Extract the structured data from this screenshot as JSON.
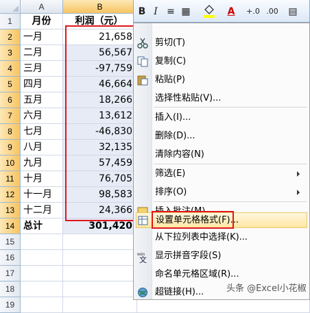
{
  "columns": [
    "A",
    "B"
  ],
  "rows": [
    {
      "num": "1",
      "a": "月份",
      "b": "利润（元）"
    },
    {
      "num": "2",
      "a": "一月",
      "b": "21,658"
    },
    {
      "num": "3",
      "a": "二月",
      "b": "56,567"
    },
    {
      "num": "4",
      "a": "三月",
      "b": "-97,759"
    },
    {
      "num": "5",
      "a": "四月",
      "b": "46,664"
    },
    {
      "num": "6",
      "a": "五月",
      "b": "18,266"
    },
    {
      "num": "7",
      "a": "六月",
      "b": "13,612"
    },
    {
      "num": "8",
      "a": "七月",
      "b": "-46,830"
    },
    {
      "num": "9",
      "a": "八月",
      "b": "32,135"
    },
    {
      "num": "10",
      "a": "九月",
      "b": "57,459"
    },
    {
      "num": "11",
      "a": "十月",
      "b": "76,705"
    },
    {
      "num": "12",
      "a": "十一月",
      "b": "98,583"
    },
    {
      "num": "13",
      "a": "十二月",
      "b": "24,366"
    },
    {
      "num": "14",
      "a": "总计",
      "b": "301,420"
    },
    {
      "num": "15",
      "a": "",
      "b": ""
    },
    {
      "num": "16",
      "a": "",
      "b": ""
    },
    {
      "num": "17",
      "a": "",
      "b": ""
    },
    {
      "num": "18",
      "a": "",
      "b": ""
    },
    {
      "num": "19",
      "a": "",
      "b": ""
    }
  ],
  "toolbar": {
    "bold": "B",
    "italic": "I",
    "align": "≡",
    "border": "▦",
    "fill_icon": "fill-color-icon",
    "font_color": "A",
    "inc_decimal": "+.0",
    "dec_decimal": ".00",
    "format": "▤"
  },
  "menu": {
    "cut": "剪切(T)",
    "copy": "复制(C)",
    "paste": "粘贴(P)",
    "paste_special": "选择性粘贴(V)...",
    "insert": "插入(I)...",
    "delete": "删除(D)...",
    "clear": "清除内容(N)",
    "filter": "筛选(E)",
    "sort": "排序(O)",
    "comment": "插入批注(M)",
    "format_cells": "设置单元格格式(F)...",
    "pick_list": "从下拉列表中选择(K)...",
    "phonetic": "显示拼音字段(S)",
    "name_range": "命名单元格区域(R)...",
    "hyperlink": "超链接(H)..."
  },
  "watermark": "头条 @Excel小花椒",
  "colors": {
    "selection_red": "#e0161b",
    "highlight": "#ffe7a3"
  }
}
